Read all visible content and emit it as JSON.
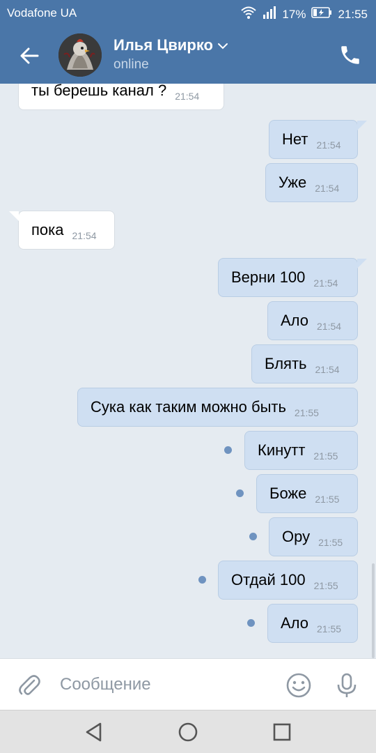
{
  "status_bar": {
    "carrier": "Vodafone UA",
    "battery": "17%",
    "time": "21:55",
    "icons": [
      "wifi-icon",
      "signal-icon",
      "battery-charging-icon"
    ]
  },
  "header": {
    "contact_name": "Илья Цвирко",
    "status": "online",
    "icons": [
      "back-arrow-icon",
      "chevron-down-icon",
      "phone-icon"
    ]
  },
  "messages": [
    {
      "direction": "in",
      "text": "ты берешь канал ?",
      "time": "21:54"
    },
    {
      "direction": "out",
      "text": "Нет",
      "time": "21:54"
    },
    {
      "direction": "out",
      "text": "Уже",
      "time": "21:54"
    },
    {
      "direction": "in",
      "text": "пока",
      "time": "21:54"
    },
    {
      "direction": "out",
      "text": "Верни 100",
      "time": "21:54"
    },
    {
      "direction": "out",
      "text": "Ало",
      "time": "21:54"
    },
    {
      "direction": "out",
      "text": "Блять",
      "time": "21:54"
    },
    {
      "direction": "out",
      "text": "Сука как таким можно быть",
      "time": "21:55"
    },
    {
      "direction": "out",
      "text": "Кинутт",
      "time": "21:55",
      "unread": true
    },
    {
      "direction": "out",
      "text": "Боже",
      "time": "21:55",
      "unread": true
    },
    {
      "direction": "out",
      "text": "Ору",
      "time": "21:55",
      "unread": true
    },
    {
      "direction": "out",
      "text": "Отдай 100",
      "time": "21:55",
      "unread": true
    },
    {
      "direction": "out",
      "text": "Ало",
      "time": "21:55",
      "unread": true
    }
  ],
  "compose": {
    "placeholder": "Сообщение",
    "icons": [
      "paperclip-icon",
      "emoji-icon",
      "microphone-icon"
    ]
  },
  "nav_bar": {
    "icons": [
      "nav-back-icon",
      "nav-home-icon",
      "nav-recents-icon"
    ]
  },
  "colors": {
    "header": "#4a76a8",
    "outgoing_bubble": "#cfdff2",
    "incoming_bubble": "#ffffff",
    "chat_background": "#e5ebf1",
    "unread_dot": "#6f93c0"
  }
}
